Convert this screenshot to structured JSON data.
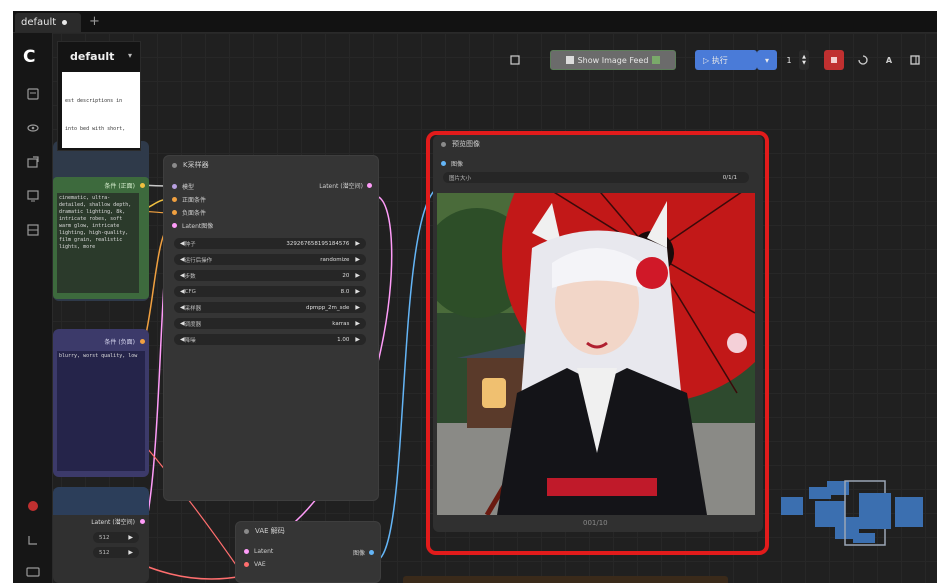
{
  "tabs": {
    "active": "default",
    "add": "+"
  },
  "workflow": {
    "title": "default",
    "chevron": "▾",
    "preview_lines": [
      "...",
      "est descriptions in",
      "...",
      "...",
      "...",
      "into bed with short,"
    ]
  },
  "toolbar": {
    "show_image_feed": "Show Image Feed",
    "run": "▷ 执行",
    "run_dropdown": "▾",
    "batch_count": "1"
  },
  "ksampler": {
    "title": "K采样器",
    "inputs": [
      "模型",
      "正面条件",
      "负面条件",
      "Latent图像"
    ],
    "output": "Latent (潜空间)",
    "widgets": [
      {
        "label": "种子",
        "value": "329267658195184576"
      },
      {
        "label": "运行后操作",
        "value": "randomize"
      },
      {
        "label": "步数",
        "value": "20"
      },
      {
        "label": "CFG",
        "value": "8.0"
      },
      {
        "label": "采样器",
        "value": "dpmpp_2m_sde"
      },
      {
        "label": "调度器",
        "value": "karras"
      },
      {
        "label": "降噪",
        "value": "1.00"
      }
    ]
  },
  "left_nodes": {
    "positive_label": "条件 (正面)",
    "negative_label": "条件 (负面)",
    "latent_label": "Latent (潜空间)",
    "positive_text": "cinematic, ultra-detailed, shallow depth, dramatic lighting, 8k, intricate robes, soft warm glow, intricate lighting, high-quality, film grain, realistic lights, more",
    "negative_text": "blurry, worst quality, low",
    "width_value": "512",
    "height_value": "512"
  },
  "preview": {
    "title": "预览图像",
    "input_label": "图像",
    "size_label": "图片大小",
    "size_value": "0/1/1",
    "caption": "001/10"
  },
  "vae": {
    "title": "VAE 解码",
    "inputs": [
      "Latent",
      "VAE"
    ],
    "output": "图像"
  },
  "colors": {
    "highlight": "#e21b1b",
    "run_button": "#4a7bd8",
    "feed_button": "#5d7d5a",
    "stop_button": "#c03030",
    "positive_node": "#3d6a3d",
    "negative_node": "#44407a",
    "model_wire": "#b8a0e0",
    "clip_wire": "#f0c040",
    "latent_wire": "#ff9cf9",
    "image_wire": "#64b5f6",
    "vae_wire": "#ff6e6e"
  }
}
